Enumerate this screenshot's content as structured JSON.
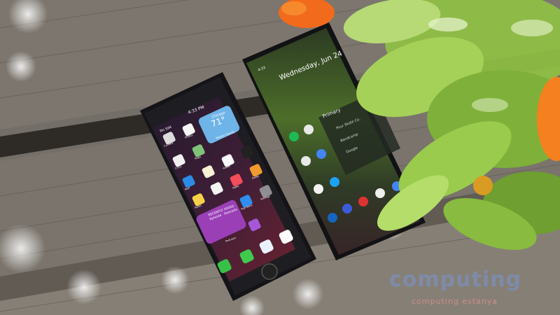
{
  "iphone": {
    "time": "4:33 PM",
    "carrier": "No SIM",
    "weather_city": "Chicago",
    "weather_temp": "71°",
    "weather_condition": "Mostly Cloudy",
    "podcast_widget": "RECENTLY SAVED · Episode · Podcasts",
    "apps": [
      "Camera",
      "Photos",
      "Clock",
      "Maps",
      "Health",
      "Mail",
      "Notes",
      "News",
      "Books",
      "Settings",
      "App Store",
      "Podcasts",
      "Phone",
      "Messages",
      "Safari",
      "Music"
    ]
  },
  "android": {
    "time": "4:33",
    "date": "Wednesday, Jun 24",
    "notification_header": "Primary",
    "notifications": [
      "Pour Skate Co.",
      "Bandcamp",
      "Google"
    ]
  },
  "watermark": {
    "brand": "computing",
    "url": "computing estanya"
  },
  "colors": {
    "wood": "#6f6a63",
    "iphone_body": "#1c1b1f",
    "android_body": "#1a1a1d",
    "leaf": "#9cc74a",
    "flower": "#f2721c"
  }
}
